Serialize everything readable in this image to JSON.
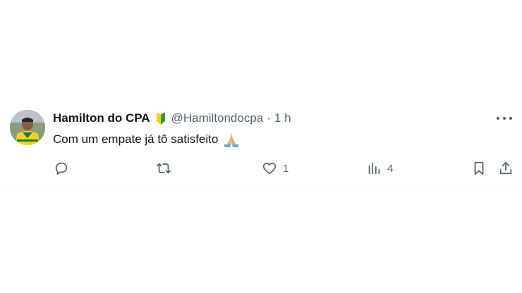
{
  "tweet": {
    "author_name": "Hamilton do CPA",
    "author_handle": "@Hamiltondocpa",
    "separator": "·",
    "timestamp": "1 h",
    "text": "Com um empate já tô satisfeito",
    "text_emoji": "folded-hands-icon",
    "badge_icon": "beginner-badge-icon"
  },
  "actions": {
    "reply_count": "",
    "retweet_count": "",
    "like_count": "1",
    "views_count": "4"
  },
  "colors": {
    "text_primary": "#0f1419",
    "text_secondary": "#536471",
    "divider": "#eff3f4"
  }
}
